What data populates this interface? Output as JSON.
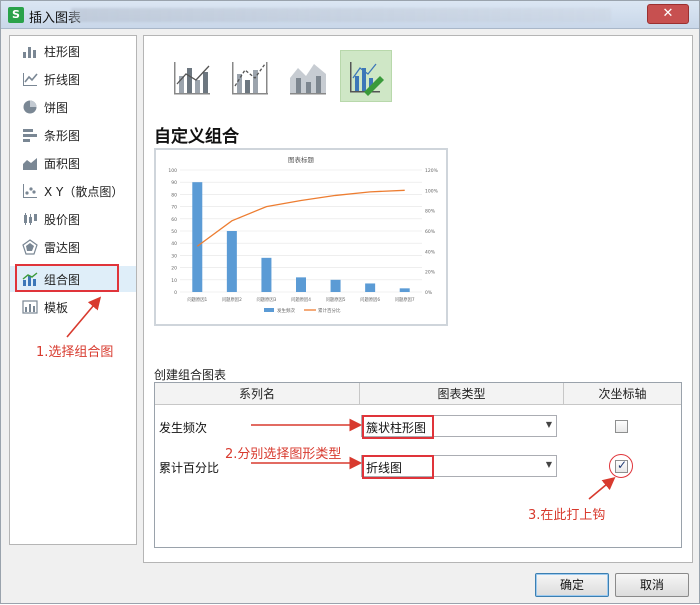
{
  "window": {
    "title": "插入图表",
    "app_icon_glyph": "S",
    "close_glyph": "✕"
  },
  "sidebar": {
    "items": [
      {
        "label": "柱形图",
        "icon": "column-chart-icon"
      },
      {
        "label": "折线图",
        "icon": "line-chart-icon"
      },
      {
        "label": "饼图",
        "icon": "pie-chart-icon"
      },
      {
        "label": "条形图",
        "icon": "bar-chart-icon"
      },
      {
        "label": "面积图",
        "icon": "area-chart-icon"
      },
      {
        "label": "X Y（散点图）",
        "icon": "scatter-chart-icon"
      },
      {
        "label": "股价图",
        "icon": "stock-chart-icon"
      },
      {
        "label": "雷达图",
        "icon": "radar-chart-icon"
      },
      {
        "label": "组合图",
        "icon": "combo-chart-icon",
        "selected": true
      },
      {
        "label": "模板",
        "icon": "template-icon"
      }
    ]
  },
  "subtypes": [
    {
      "icon": "combo-column-line-icon"
    },
    {
      "icon": "combo-column-line-secondary-axis-icon"
    },
    {
      "icon": "combo-area-column-icon"
    },
    {
      "icon": "custom-combo-icon",
      "selected": true
    }
  ],
  "section_title": "自定义组合",
  "preview_chart": {
    "title": "图表标题",
    "left_axis_ticks": [
      "100",
      "90",
      "80",
      "70",
      "60",
      "50",
      "40",
      "30",
      "20",
      "10",
      "0"
    ],
    "right_axis_ticks": [
      "120%",
      "100%",
      "80%",
      "60%",
      "40%",
      "20%",
      "0%"
    ],
    "categories": [
      "问题原因1",
      "问题原因2",
      "问题原因3",
      "问题原因4",
      "问题原因5",
      "问题原因6",
      "问题原因7"
    ],
    "bar_color": "#5b9bd5",
    "line_color": "#ed7d31",
    "legend": [
      "发生频次",
      "累计百分比"
    ]
  },
  "chart_data": {
    "type": "bar",
    "title": "图表标题",
    "categories": [
      "问题原因1",
      "问题原因2",
      "问题原因3",
      "问题原因4",
      "问题原因5",
      "问题原因6",
      "问题原因7"
    ],
    "series": [
      {
        "name": "发生频次",
        "type": "bar",
        "axis": "primary",
        "values": [
          90,
          50,
          28,
          12,
          10,
          7,
          3
        ]
      },
      {
        "name": "累计百分比",
        "type": "line",
        "axis": "secondary",
        "values": [
          0.45,
          0.7,
          0.84,
          0.9,
          0.95,
          0.985,
          1.0
        ]
      }
    ],
    "ylim": [
      0,
      100
    ],
    "y2lim": [
      0,
      1.2
    ],
    "grid": true,
    "legend": "bottom"
  },
  "combo": {
    "section_label": "创建组合图表",
    "headers": {
      "series_name": "系列名",
      "chart_type": "图表类型",
      "secondary_axis": "次坐标轴"
    },
    "rows": [
      {
        "name": "发生频次",
        "chart_type": "簇状柱形图",
        "secondary": false
      },
      {
        "name": "累计百分比",
        "chart_type": "折线图",
        "secondary": true
      }
    ]
  },
  "footer": {
    "ok": "确定",
    "cancel": "取消"
  },
  "annotations": {
    "step1": "1.选择组合图",
    "step2": "2.分别选择图形类型",
    "step3": "3.在此打上钩",
    "color": "#d83a2e"
  }
}
